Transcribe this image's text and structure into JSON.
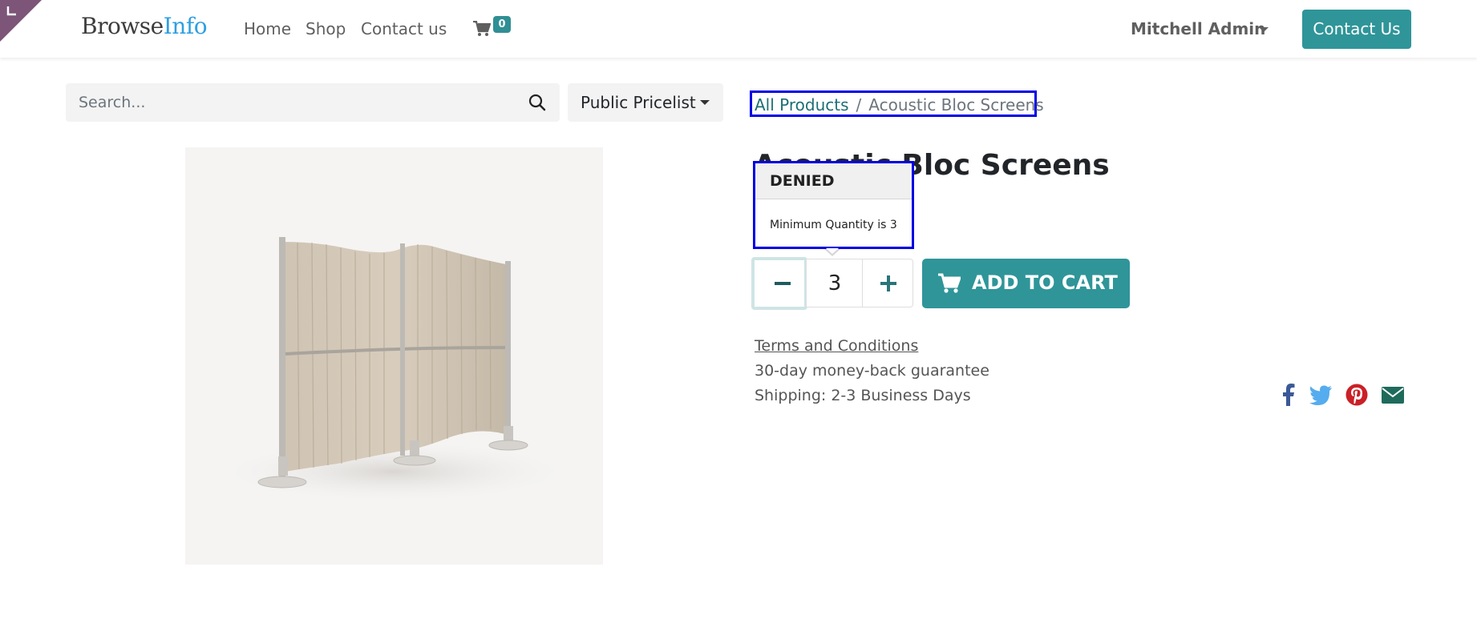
{
  "header": {
    "logo_part1": "Browse",
    "logo_part2": "Info",
    "nav": [
      "Home",
      "Shop",
      "Contact us"
    ],
    "cart_count": "0",
    "user_name": "Mitchell Admin",
    "contact_button": "Contact Us"
  },
  "search": {
    "placeholder": "Search...",
    "pricelist": "Public Pricelist"
  },
  "breadcrumb": {
    "parent": "All Products",
    "separator": "/",
    "current": "Acoustic Bloc Screens"
  },
  "product": {
    "title": "Acoustic Bloc Screens",
    "quantity": "3",
    "add_to_cart": "ADD TO CART",
    "terms": "Terms and Conditions",
    "guarantee": "30-day money-back guarantee",
    "shipping": "Shipping: 2-3 Business Days"
  },
  "popover": {
    "title": "DENIED",
    "message": "Minimum Quantity is 3"
  },
  "colors": {
    "brand": "#2f9599",
    "logo_accent": "#2f9fe0",
    "highlight": "#0000e6"
  },
  "social_icons": [
    "facebook-icon",
    "twitter-icon",
    "pinterest-icon",
    "envelope-icon"
  ]
}
